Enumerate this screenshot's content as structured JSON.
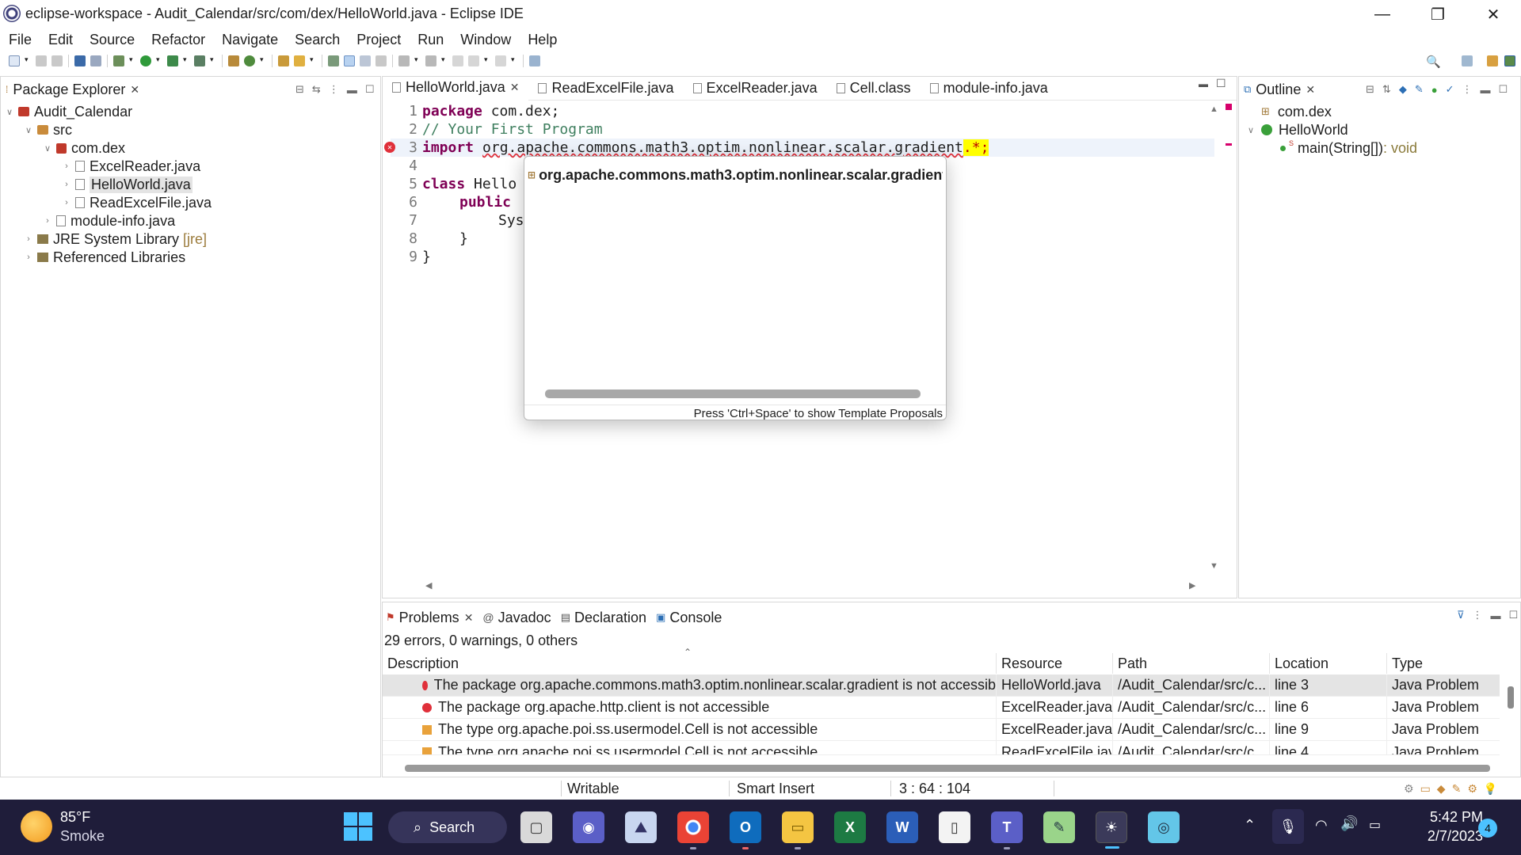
{
  "window": {
    "title": "eclipse-workspace - Audit_Calendar/src/com/dex/HelloWorld.java - Eclipse IDE",
    "minimize": "—",
    "maximize": "❐",
    "close": "✕"
  },
  "menu": [
    "File",
    "Edit",
    "Source",
    "Refactor",
    "Navigate",
    "Search",
    "Project",
    "Run",
    "Window",
    "Help"
  ],
  "package_explorer": {
    "tab_label": "Package Explorer",
    "tree": [
      {
        "label": "Audit_Calendar",
        "icon": "project-icon"
      },
      {
        "label": "src",
        "icon": "source-folder-icon"
      },
      {
        "label": "com.dex",
        "icon": "package-icon"
      },
      {
        "label": "ExcelReader.java",
        "icon": "java-file-icon"
      },
      {
        "label": "HelloWorld.java",
        "icon": "java-file-icon",
        "selected": true
      },
      {
        "label": "ReadExcelFile.java",
        "icon": "java-file-icon"
      },
      {
        "label": "module-info.java",
        "icon": "java-file-icon"
      },
      {
        "label": "JRE System Library",
        "suffix": "[jre]",
        "icon": "library-icon"
      },
      {
        "label": "Referenced Libraries",
        "icon": "library-icon"
      }
    ]
  },
  "editor": {
    "tabs": [
      "HelloWorld.java",
      "ReadExcelFile.java",
      "ExcelReader.java",
      "Cell.class",
      "module-info.java"
    ],
    "line_numbers": [
      "1",
      "2",
      "3",
      "4",
      "5",
      "6",
      "7",
      "8",
      "9"
    ],
    "code": {
      "l1_kw": "package",
      "l1_rest": " com.dex;",
      "l2": "// Your First Program",
      "l3_kw": "import",
      "l3_pkg": "org.apache.commons.math3.optim.nonlinear.scalar.gradient",
      "l3_tail": ".*;",
      "l5_kw": "class",
      "l5_rest": " Hello",
      "l6_kw": "public",
      "l7": "Sys",
      "l8": "}",
      "l9": "}"
    }
  },
  "content_assist": {
    "proposal": "org.apache.commons.math3.optim.nonlinear.scalar.gradient",
    "hint": "Press 'Ctrl+Space' to show Template Proposals"
  },
  "outline": {
    "tab_label": "Outline",
    "items": [
      {
        "label": "com.dex"
      },
      {
        "label": "HelloWorld"
      },
      {
        "label": "main(String[])",
        "type": " : void"
      }
    ]
  },
  "problems": {
    "tabs": [
      "Problems",
      "Javadoc",
      "Declaration",
      "Console"
    ],
    "summary": "29 errors, 0 warnings, 0 others",
    "columns": [
      "Description",
      "Resource",
      "Path",
      "Location",
      "Type"
    ],
    "rows": [
      {
        "severity": "error",
        "description": "The package org.apache.commons.math3.optim.nonlinear.scalar.gradient is not accessib",
        "resource": "HelloWorld.java",
        "path": "/Audit_Calendar/src/c...",
        "location": "line 3",
        "type": "Java Problem"
      },
      {
        "severity": "error",
        "description": "The package org.apache.http.client is not accessible",
        "resource": "ExcelReader.java",
        "path": "/Audit_Calendar/src/c...",
        "location": "line 6",
        "type": "Java Problem"
      },
      {
        "severity": "warning",
        "description": "The type org.apache.poi.ss.usermodel.Cell is not accessible",
        "resource": "ExcelReader.java",
        "path": "/Audit_Calendar/src/c...",
        "location": "line 9",
        "type": "Java Problem"
      },
      {
        "severity": "warning",
        "description": "The type org.apache.poi.ss.usermodel.Cell is not accessible",
        "resource": "ReadExcelFile.java",
        "path": "/Audit_Calendar/src/c...",
        "location": "line 4",
        "type": "Java Problem"
      }
    ]
  },
  "status": {
    "writable": "Writable",
    "insert_mode": "Smart Insert",
    "position": "3 : 64 : 104"
  },
  "taskbar": {
    "weather_temp": "85°F",
    "weather_desc": "Smoke",
    "search_label": "Search",
    "time": "5:42 PM",
    "date": "2/7/2023",
    "notification_count": "4"
  },
  "colors": {
    "keyword": "#7f0055",
    "comment": "#3f7f5f",
    "error": "#e0303a",
    "taskbar": "#1f1d3a",
    "highlight": "#ffff00"
  }
}
